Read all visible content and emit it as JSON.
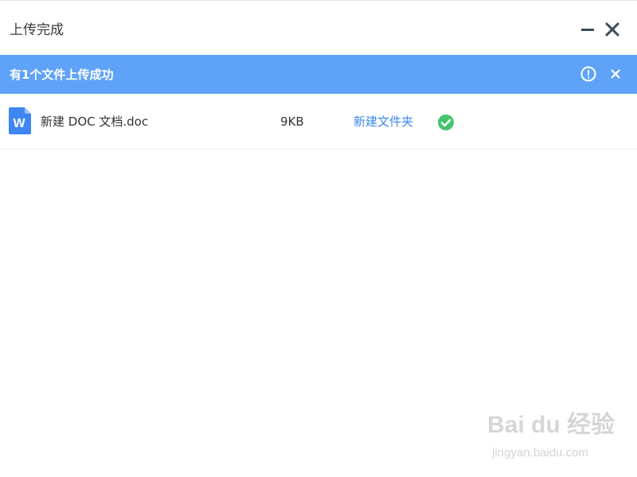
{
  "window": {
    "title": "上传完成"
  },
  "banner": {
    "message": "有1个文件上传成功",
    "color": "#5ea3f8"
  },
  "files": [
    {
      "type_icon": "word-doc-icon",
      "icon_letter": "W",
      "name": "新建 DOC 文档.doc",
      "size": "9KB",
      "folder": "新建文件夹",
      "status": "success",
      "status_icon": "check-circle-icon",
      "status_color": "#46c46e"
    }
  ],
  "colors": {
    "accent": "#5ea3f8",
    "link": "#3b87e8",
    "success": "#46c46e",
    "doc_icon": "#3f86f4"
  },
  "watermark": {
    "logo": "Bai du 经验",
    "url": "jingyan.baidu.com"
  }
}
